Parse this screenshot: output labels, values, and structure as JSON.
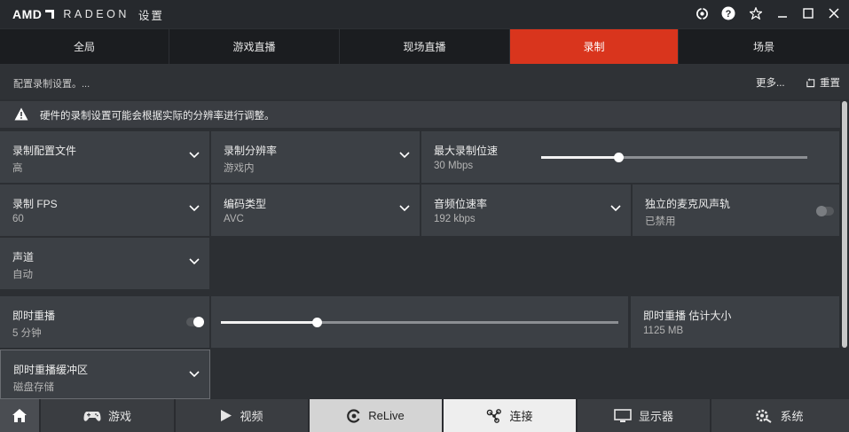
{
  "titlebar": {
    "brand": "AMD",
    "product": "RADEON",
    "title": "设置",
    "icons": [
      "update-icon",
      "help-icon",
      "favorite-icon",
      "minimize-icon",
      "maximize-icon",
      "close-icon"
    ]
  },
  "tabs": [
    {
      "label": "全局",
      "active": false
    },
    {
      "label": "游戏直播",
      "active": false
    },
    {
      "label": "现场直播",
      "active": false
    },
    {
      "label": "录制",
      "active": true
    },
    {
      "label": "场景",
      "active": false
    }
  ],
  "subheader": {
    "description": "配置录制设置。...",
    "more": "更多...",
    "reset": "重置"
  },
  "warning": {
    "text": "硬件的录制设置可能会根据实际的分辨率进行调整。"
  },
  "settings": {
    "profile": {
      "label": "录制配置文件",
      "value": "高"
    },
    "resolution": {
      "label": "录制分辨率",
      "value": "游戏内"
    },
    "bitrate": {
      "label": "最大录制位速",
      "value": "30 Mbps",
      "slider_fraction": 0.29
    },
    "fps": {
      "label": "录制 FPS",
      "value": "60"
    },
    "encoding": {
      "label": "编码类型",
      "value": "AVC"
    },
    "audio_bitrate": {
      "label": "音频位速率",
      "value": "192 kbps"
    },
    "mic_track": {
      "label": "独立的麦克风声轨",
      "value": "已禁用",
      "enabled": false
    },
    "channel": {
      "label": "声道",
      "value": "自动"
    },
    "instant_replay": {
      "label": "即时重播",
      "value": "5 分钟",
      "enabled": true,
      "slider_fraction": 0.24
    },
    "replay_size": {
      "label": "即时重播 估计大小",
      "value": "1125 MB"
    },
    "replay_buffer": {
      "label": "即时重播缓冲区",
      "value": "磁盘存储"
    }
  },
  "bottom_nav": [
    {
      "label": "",
      "icon": "home-icon"
    },
    {
      "label": "游戏",
      "icon": "gamepad-icon"
    },
    {
      "label": "视频",
      "icon": "play-icon"
    },
    {
      "label": "ReLive",
      "icon": "relive-icon"
    },
    {
      "label": "连接",
      "icon": "connect-icon",
      "active": true
    },
    {
      "label": "显示器",
      "icon": "monitor-icon"
    },
    {
      "label": "系统",
      "icon": "system-gear-icon"
    }
  ],
  "colors": {
    "accent": "#d9351d",
    "background": "#2c2f33",
    "cell": "#3c4045"
  }
}
